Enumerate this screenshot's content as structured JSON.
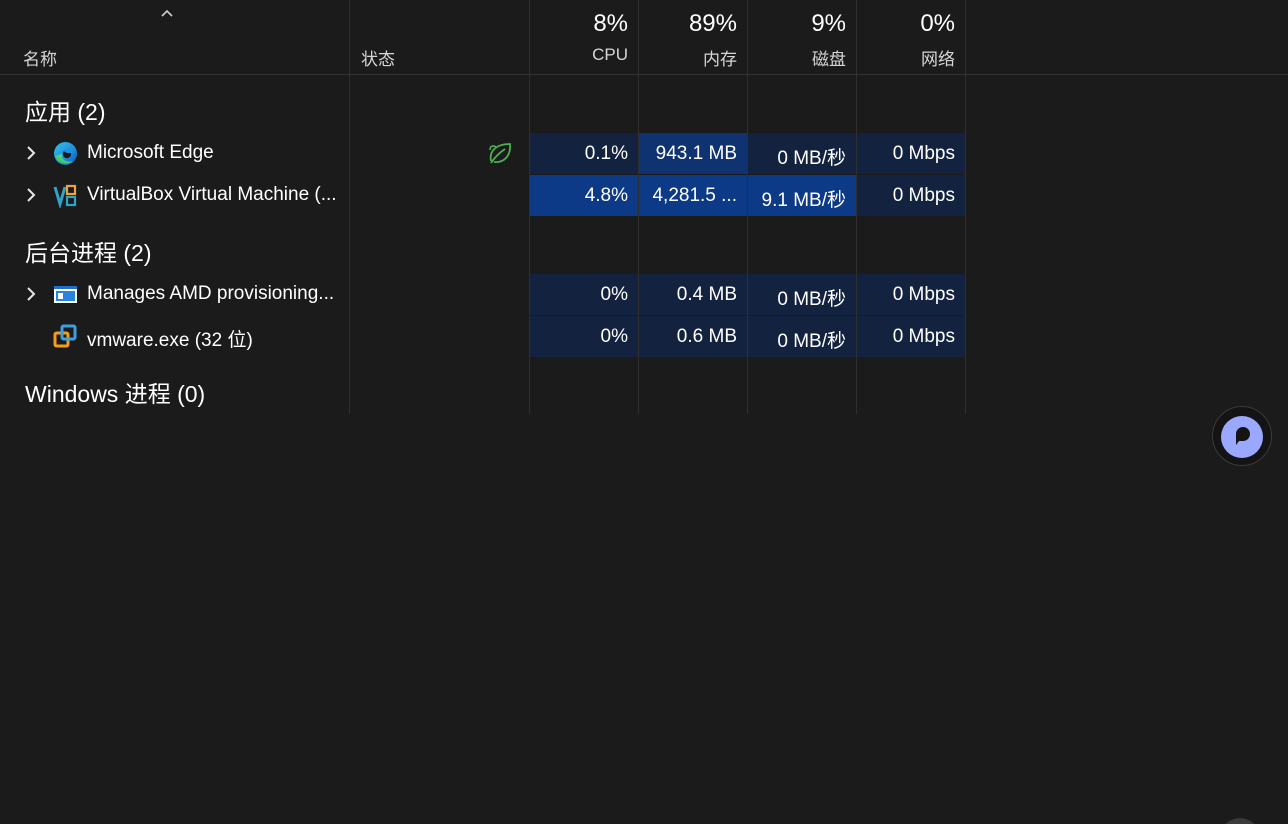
{
  "header": {
    "name_label": "名称",
    "status_label": "状态",
    "columns": [
      {
        "percent": "8%",
        "label": "CPU"
      },
      {
        "percent": "89%",
        "label": "内存"
      },
      {
        "percent": "9%",
        "label": "磁盘"
      },
      {
        "percent": "0%",
        "label": "网络"
      }
    ]
  },
  "groups": {
    "apps": {
      "title": "应用 (2)",
      "rows": [
        {
          "name": "Microsoft Edge",
          "cpu": "0.1%",
          "memory": "943.1 MB",
          "disk": "0 MB/秒",
          "network": "0 Mbps",
          "icon": "edge-icon",
          "efficiency_mode": true
        },
        {
          "name": "VirtualBox Virtual Machine (...",
          "cpu": "4.8%",
          "memory": "4,281.5 ...",
          "disk": "9.1 MB/秒",
          "network": "0 Mbps",
          "icon": "virtualbox-icon",
          "efficiency_mode": false
        }
      ]
    },
    "background": {
      "title": "后台进程 (2)",
      "rows": [
        {
          "name": "Manages AMD provisioning...",
          "cpu": "0%",
          "memory": "0.4 MB",
          "disk": "0 MB/秒",
          "network": "0 Mbps",
          "icon": "amd-window-icon"
        },
        {
          "name": "vmware.exe (32 位)",
          "cpu": "0%",
          "memory": "0.6 MB",
          "disk": "0 MB/秒",
          "network": "0 Mbps",
          "icon": "vmware-icon"
        }
      ]
    },
    "windows": {
      "title": "Windows 进程 (0)"
    }
  },
  "colors": {
    "background": "#1b1b1b",
    "heat_low": "#13233f",
    "heat_mid": "#0f2d5c",
    "heat_high": "#0d3a86",
    "leaf_green": "#4caf50",
    "fab_accent": "#9aa8ff"
  }
}
